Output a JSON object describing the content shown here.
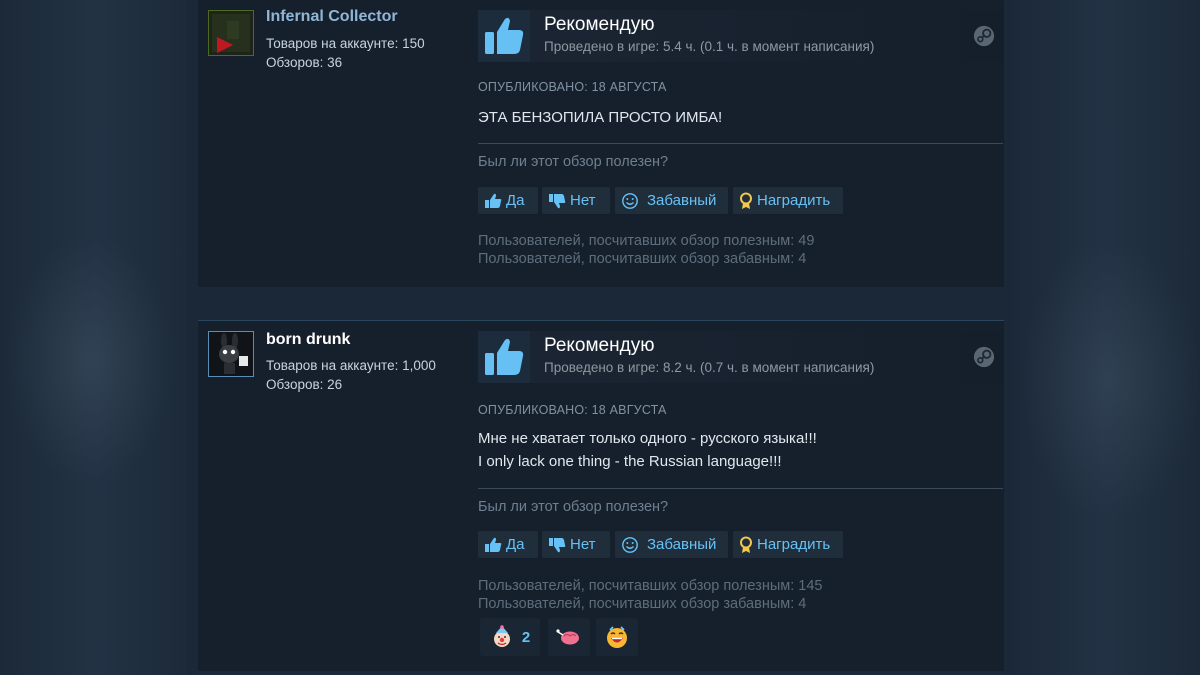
{
  "reviews": [
    {
      "author": {
        "name": "Infernal Collector",
        "name_color": "#8fb7d5",
        "avatar_icon": "avatar-red-arrow",
        "products_label": "Товаров на аккаунте: 150",
        "reviews_label": "Обзоров: 36"
      },
      "verdict": "Рекомендую",
      "playtime": "Проведено в игре: 5.4 ч. (0.1 ч. в момент написания)",
      "posted": "Опубликовано: 18 августа",
      "text_lines": [
        "ЭТА БЕНЗОПИЛА ПРОСТО ИМБА!"
      ],
      "helpful_question": "Был ли этот обзор полезен?",
      "buttons": {
        "yes": "Да",
        "no": "Нет",
        "funny": "Забавный",
        "award": "Наградить"
      },
      "helpful_count": "Пользователей, посчитавших обзор полезным: 49",
      "funny_count": "Пользователей, посчитавших обзор забавным: 4",
      "awards": []
    },
    {
      "author": {
        "name": "born drunk",
        "name_color": "#ffffff",
        "avatar_icon": "avatar-cartoon-bunny",
        "products_label": "Товаров на аккаунте: 1,000",
        "reviews_label": "Обзоров: 26"
      },
      "verdict": "Рекомендую",
      "playtime": "Проведено в игре: 8.2 ч. (0.7 ч. в момент написания)",
      "posted": "Опубликовано: 18 августа",
      "text_lines": [
        "Мне не хватает только одного - русского языка!!!",
        "I only lack one thing - the Russian language!!!"
      ],
      "helpful_question": "Был ли этот обзор полезен?",
      "buttons": {
        "yes": "Да",
        "no": "Нет",
        "funny": "Забавный",
        "award": "Наградить"
      },
      "helpful_count": "Пользователей, посчитавших обзор полезным: 145",
      "funny_count": "Пользователей, посчитавших обзор забавным: 4",
      "awards": [
        {
          "icon": "clown-face-award-icon",
          "count": "2"
        },
        {
          "icon": "brain-award-icon",
          "count": ""
        },
        {
          "icon": "laughing-face-award-icon",
          "count": ""
        }
      ]
    }
  ],
  "colors": {
    "page_bg": "#1b2838",
    "card_bg": "#16202d",
    "link_blue": "#67c1f5",
    "thumb_blue": "#66c0f4",
    "award_gold": "#f3c74f"
  }
}
